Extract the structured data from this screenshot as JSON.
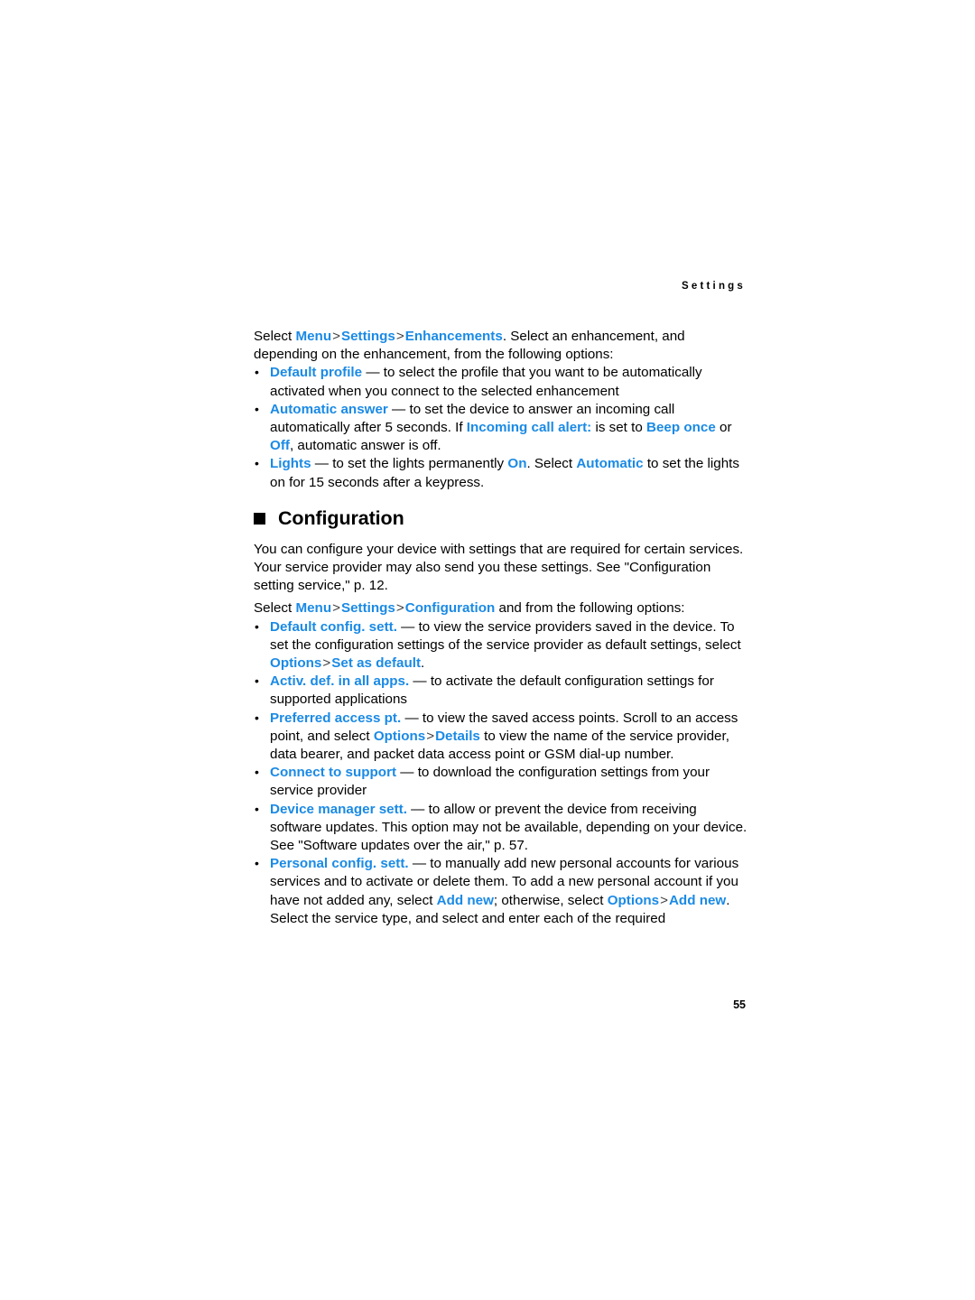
{
  "header": {
    "running_head": "Settings",
    "page_number": "55"
  },
  "enhancements": {
    "intro": {
      "lead": "Select ",
      "menu": "Menu",
      "sep1": ">",
      "settings": "Settings",
      "sep2": ">",
      "enhancements": "Enhancements",
      "tail": ". Select an enhancement, and depending on the enhancement, from the following options:"
    },
    "items": [
      {
        "term": "Default profile",
        "dash": " — ",
        "text": "to select the profile that you want to be automatically activated when you connect to the selected enhancement"
      },
      {
        "term": "Automatic answer",
        "dash": " — ",
        "text_a": "to set the device to answer an incoming call automatically after 5 seconds. If ",
        "ui_a": "Incoming call alert:",
        "text_b": " is set to ",
        "ui_b": "Beep once",
        "text_c": " or ",
        "ui_c": "Off",
        "text_d": ", automatic answer is off."
      },
      {
        "term": "Lights",
        "dash": " — ",
        "text_a": "to set the lights permanently ",
        "ui_a": "On",
        "text_b": ". Select ",
        "ui_b": "Automatic",
        "text_c": " to set the lights on for 15 seconds after a keypress."
      }
    ]
  },
  "configuration": {
    "heading": "Configuration",
    "intro_paragraph": "You can configure your device with settings that are required for certain services. Your service provider may also send you these settings. See \"Configuration setting service,\" p. 12.",
    "select_line": {
      "lead": "Select ",
      "menu": "Menu",
      "sep1": ">",
      "settings": "Settings",
      "sep2": ">",
      "configuration": "Configuration",
      "tail": " and from the following options:"
    },
    "items": [
      {
        "term": "Default config. sett.",
        "dash": " — ",
        "text_a": "to view the service providers saved in the device. To set the configuration settings of the service provider as default settings, select ",
        "ui_a": "Options",
        "sep_a": ">",
        "ui_b": "Set as default",
        "text_b": "."
      },
      {
        "term": "Activ. def. in all apps.",
        "dash": " — ",
        "text": "to activate the default configuration settings for supported applications"
      },
      {
        "term": "Preferred access pt.",
        "dash": " — ",
        "text_a": "to view the saved access points. Scroll to an access point, and select ",
        "ui_a": "Options",
        "sep_a": ">",
        "ui_b": "Details",
        "text_b": " to view the name of the service provider, data bearer, and packet data access point or GSM dial-up number."
      },
      {
        "term": "Connect to support",
        "dash": " — ",
        "text": "to download the configuration settings from your service provider"
      },
      {
        "term": "Device manager sett.",
        "dash": " — ",
        "text": "to allow or prevent the device from receiving software updates. This option may not be available, depending on your device. See \"Software updates over the air,\" p. 57."
      },
      {
        "term": "Personal config. sett.",
        "dash": " — ",
        "text_a": "to manually add new personal accounts for various services and to activate or delete them. To add a new personal account if you have not added any, select ",
        "ui_a": "Add new",
        "text_b": "; otherwise, select ",
        "ui_b": "Options",
        "sep_a": ">",
        "ui_c": "Add new",
        "text_c": ". Select the service type, and select and enter each of the required"
      }
    ]
  },
  "colors": {
    "link_blue": "#1a8ae5",
    "text_black": "#000000",
    "page_background": "#ffffff"
  }
}
